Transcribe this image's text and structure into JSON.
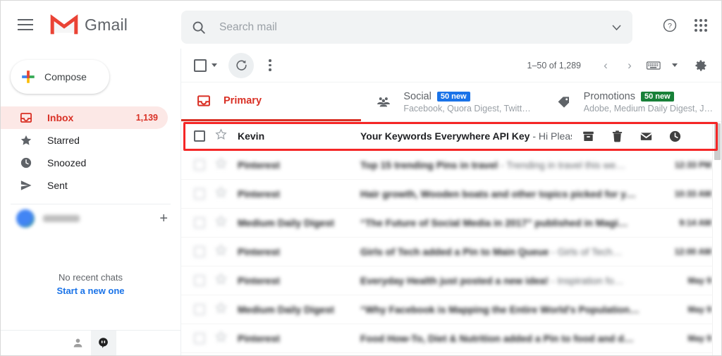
{
  "app": {
    "brand": "Gmail",
    "menu_icon": "hamburger-icon",
    "logo_icon": "gmail-m-logo"
  },
  "search": {
    "placeholder": "Search mail",
    "value": "",
    "icon": "search-icon",
    "options_icon": "chevron-down-icon"
  },
  "header_actions": [
    {
      "name": "help-icon",
      "label": "?"
    },
    {
      "name": "apps-grid-icon",
      "label": ""
    }
  ],
  "sidebar": {
    "compose": {
      "label": "Compose",
      "icon": "plus-icon"
    },
    "items": [
      {
        "label": "Inbox",
        "count": "1,139",
        "icon": "inbox-icon",
        "active": true
      },
      {
        "label": "Starred",
        "count": "",
        "icon": "star-icon",
        "active": false
      },
      {
        "label": "Snoozed",
        "count": "",
        "icon": "clock-icon",
        "active": false
      },
      {
        "label": "Sent",
        "count": "",
        "icon": "send-icon",
        "active": false
      }
    ],
    "chat_user": {
      "name_redacted": true,
      "add_label": "+"
    },
    "chat": {
      "empty_text": "No recent chats",
      "start_link": "Start a new one"
    },
    "footer_icons": [
      {
        "name": "contacts-person-icon",
        "selected": false
      },
      {
        "name": "hangouts-chat-icon",
        "selected": true
      }
    ]
  },
  "toolbar": {
    "select_all_checkbox": "select-all-checkbox",
    "select_caret": "chevron-down-icon",
    "refresh_icon": "refresh-icon",
    "more_icon": "more-vertical-icon",
    "pagination": "1–50 of 1,289",
    "prev_label": "‹",
    "next_label": "›",
    "keyboard_icon": "keyboard-icon",
    "keyboard_caret": "chevron-down-icon",
    "settings_icon": "gear-icon"
  },
  "tabs": [
    {
      "label": "Primary",
      "sub": "",
      "badge": "",
      "badge_color": "",
      "icon": "inbox-icon",
      "active": true
    },
    {
      "label": "Social",
      "sub": "Facebook, Quora Digest, Twitt…",
      "badge": "50 new",
      "badge_color": "#1a73e8",
      "icon": "people-icon",
      "active": false
    },
    {
      "label": "Promotions",
      "sub": "Adobe, Medium Daily Digest, J…",
      "badge": "50 new",
      "badge_color": "#188038",
      "icon": "tag-icon",
      "active": false
    }
  ],
  "highlight": {
    "color": "#f52626",
    "target_row": 0
  },
  "mail_rows": [
    {
      "sender": "Kevin",
      "subject": "Your Keywords Everywhere API Key",
      "snippet": " - Hi Pleas…",
      "date": "",
      "blurred": false,
      "hovered": true,
      "actions": [
        {
          "name": "archive-icon"
        },
        {
          "name": "delete-icon"
        },
        {
          "name": "mark-unread-icon"
        },
        {
          "name": "snooze-clock-icon"
        }
      ]
    },
    {
      "sender": "Pinterest",
      "subject": "Top 15 trending Pins in travel",
      "snippet": " - Trending in travel this we…",
      "date": "12:33 PM",
      "blurred": true,
      "hovered": false,
      "actions": []
    },
    {
      "sender": "Pinterest",
      "subject": "Hair growth, Wooden boats and other topics picked for y…",
      "snippet": "",
      "date": "10:33 AM",
      "blurred": true,
      "hovered": false,
      "actions": []
    },
    {
      "sender": "Medium Daily Digest",
      "subject": "“The Future of Social Media in 2017” published in Magi…",
      "snippet": "",
      "date": "9:14 AM",
      "blurred": true,
      "hovered": false,
      "actions": []
    },
    {
      "sender": "Pinterest",
      "subject": "Girls of Tech added a Pin to Main Queue",
      "snippet": " - Girls of Tech…",
      "date": "12:00 AM",
      "blurred": true,
      "hovered": false,
      "actions": []
    },
    {
      "sender": "Pinterest",
      "subject": "Everyday Health just posted a new idea!",
      "snippet": " - Inspiration fo…",
      "date": "May 9",
      "blurred": true,
      "hovered": false,
      "actions": []
    },
    {
      "sender": "Medium Daily Digest",
      "subject": "“Why Facebook is Mapping the Entire World's Population…",
      "snippet": "",
      "date": "May 9",
      "blurred": true,
      "hovered": false,
      "actions": []
    },
    {
      "sender": "Pinterest",
      "subject": "Food How-To, Diet & Nutrition added a Pin to food and d…",
      "snippet": "",
      "date": "May 9",
      "blurred": true,
      "hovered": false,
      "actions": []
    }
  ],
  "scrollbar": {
    "name": "mail-list-scrollbar"
  }
}
